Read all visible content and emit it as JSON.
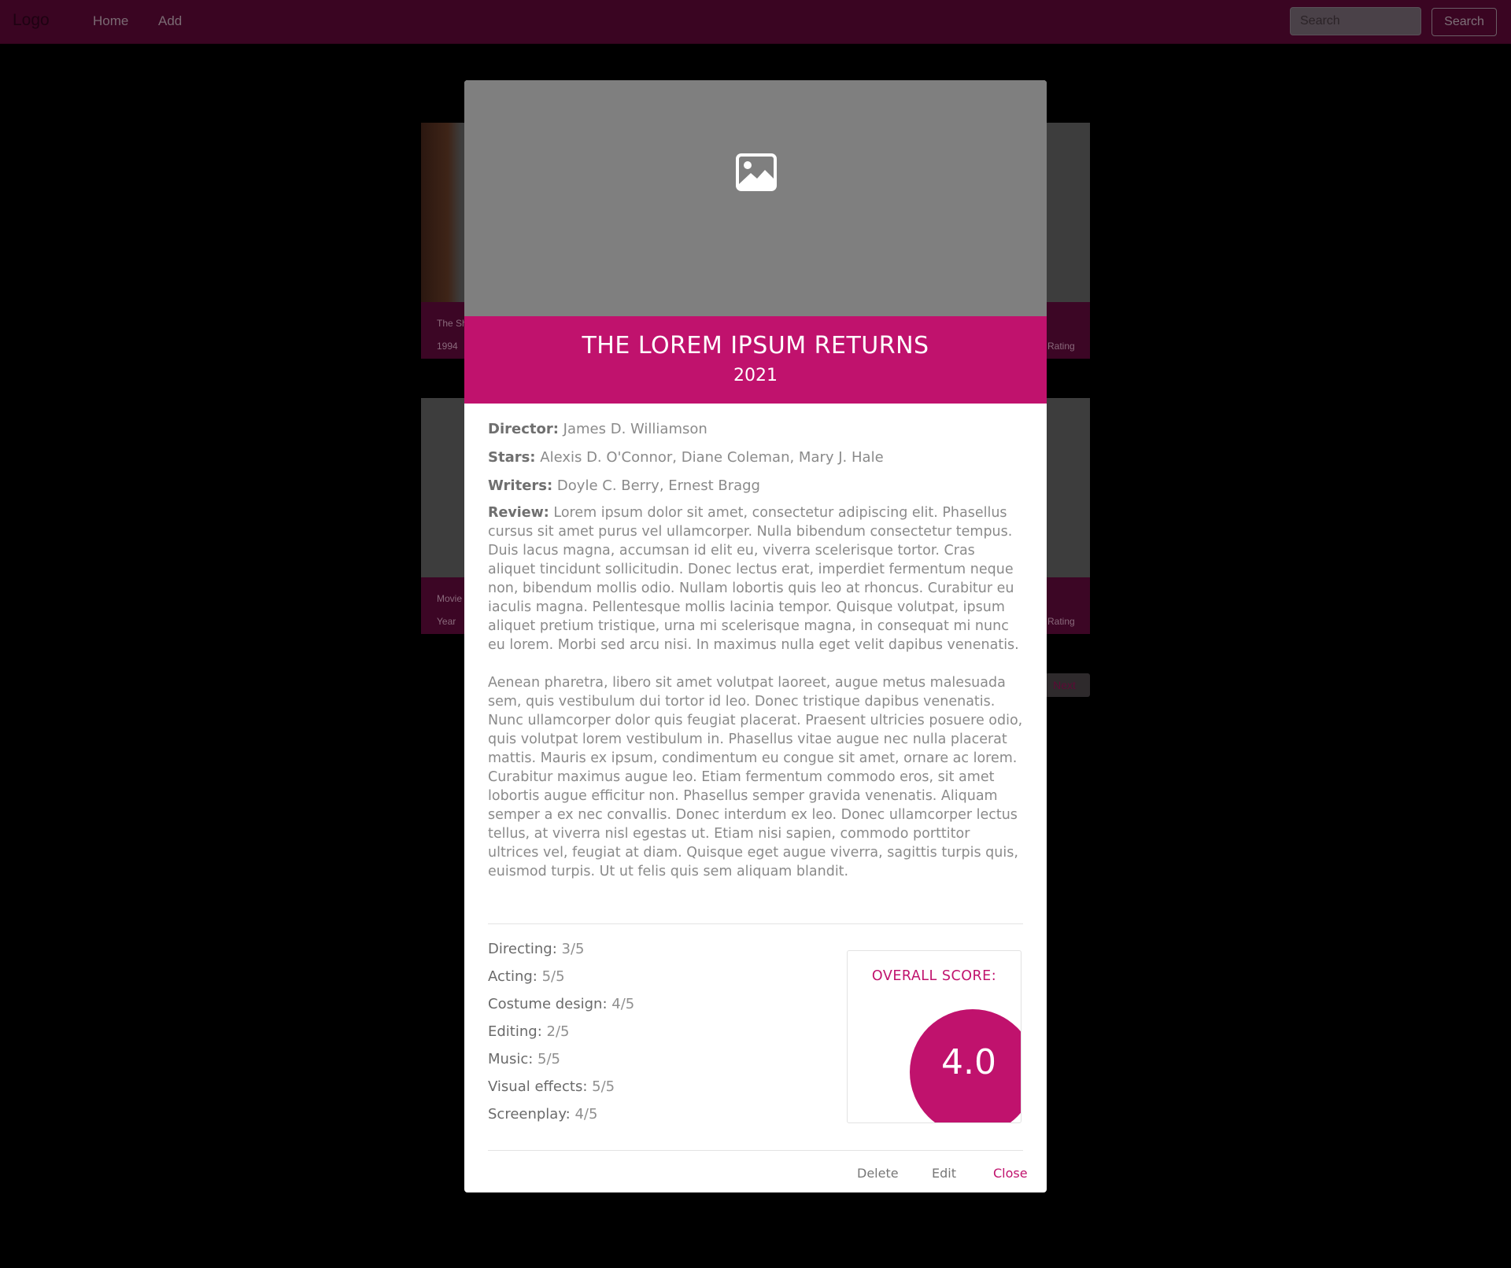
{
  "navbar": {
    "logo": "Logo",
    "links": [
      "Home",
      "Add"
    ],
    "search_placeholder": "Search",
    "search_button": "Search"
  },
  "background_cards": [
    {
      "title": "The Sh",
      "year": "1994",
      "rating_label": "Rating"
    },
    {
      "title": "Movie",
      "year": "Year",
      "rating_label": "Rating"
    }
  ],
  "pagination": {
    "next_label": "Next"
  },
  "modal": {
    "title": "THE LOREM IPSUM RETURNS",
    "year": "2021",
    "credits": {
      "director_label": "Director:",
      "director": "James D. Williamson",
      "stars_label": "Stars:",
      "stars": "Alexis D. O'Connor, Diane Coleman, Mary J. Hale",
      "writers_label": "Writers:",
      "writers": "Doyle C. Berry, Ernest Bragg"
    },
    "review_label": "Review:",
    "review_paragraphs": [
      "Lorem ipsum dolor sit amet, consectetur adipiscing elit. Phasellus cursus sit amet purus vel ullamcorper. Nulla bibendum consectetur tempus. Duis lacus magna, accumsan id elit eu, viverra scelerisque tortor. Cras aliquet tincidunt sollicitudin. Donec lectus erat, imperdiet fermentum neque non, bibendum mollis odio. Nullam lobortis quis leo at rhoncus. Curabitur eu iaculis magna. Pellentesque mollis lacinia tempor. Quisque volutpat, ipsum aliquet pretium tristique, urna mi scelerisque magna, in consequat mi nunc eu lorem. Morbi sed arcu nisi. In maximus nulla eget velit dapibus venenatis.",
      "Aenean pharetra, libero sit amet volutpat laoreet, augue metus malesuada sem, quis vestibulum dui tortor id leo. Donec tristique dapibus venenatis. Nunc ullamcorper dolor quis feugiat placerat. Praesent ultricies posuere odio, quis volutpat lorem vestibulum in. Phasellus vitae augue nec nulla placerat mattis. Mauris ex ipsum, condimentum eu congue sit amet, ornare ac lorem. Curabitur maximus augue leo. Etiam fermentum commodo eros, sit amet lobortis augue efficitur non. Phasellus semper gravida venenatis. Aliquam semper a ex nec convallis. Donec interdum ex leo. Donec ullamcorper lectus tellus, at viverra nisl egestas ut. Etiam nisi sapien, commodo porttitor ultrices vel, feugiat at diam. Quisque eget augue viverra, sagittis turpis quis, euismod turpis. Ut ut felis quis sem aliquam blandit."
    ],
    "ratings": [
      {
        "label": "Directing:",
        "value": "3/5"
      },
      {
        "label": "Acting:",
        "value": "5/5"
      },
      {
        "label": "Costume design:",
        "value": "4/5"
      },
      {
        "label": "Editing:",
        "value": "2/5"
      },
      {
        "label": "Music:",
        "value": "5/5"
      },
      {
        "label": "Visual effects:",
        "value": "5/5"
      },
      {
        "label": "Screenplay:",
        "value": "4/5"
      }
    ],
    "overall_label": "OVERALL SCORE:",
    "overall_score": "4.0",
    "buttons": {
      "delete": "Delete",
      "edit": "Edit",
      "close": "Close"
    },
    "accent_color": "#c0126d"
  }
}
